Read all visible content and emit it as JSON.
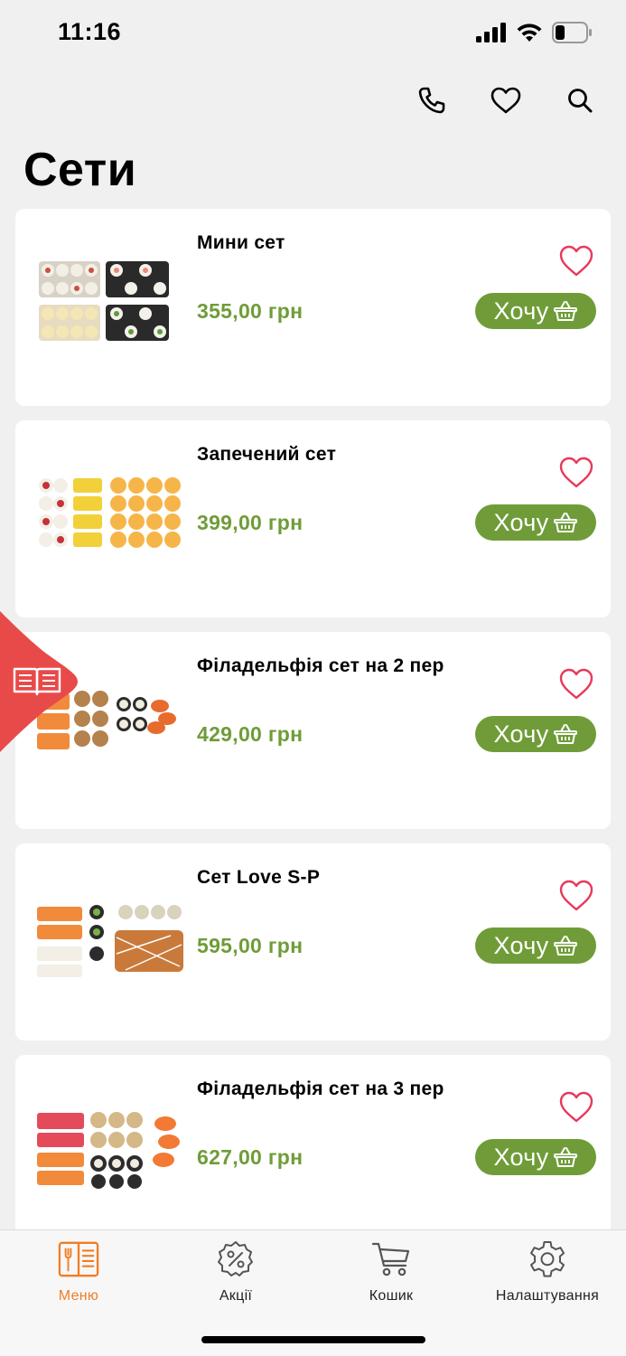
{
  "status": {
    "time": "11:16"
  },
  "page": {
    "title": "Сети"
  },
  "products": [
    {
      "name": "Мини сет",
      "price": "355,00 грн",
      "button": "Хочу"
    },
    {
      "name": "Запечений сет",
      "price": "399,00 грн",
      "button": "Хочу"
    },
    {
      "name": "Філадельфія сет на 2 пер",
      "price": "429,00 грн",
      "button": "Хочу"
    },
    {
      "name": "Сет Love S-P",
      "price": "595,00 грн",
      "button": "Хочу"
    },
    {
      "name": "Філадельфія сет на 3 пер",
      "price": "627,00 грн",
      "button": "Хочу"
    }
  ],
  "nav": [
    {
      "label": "Меню",
      "icon": "menu-book-icon",
      "active": true
    },
    {
      "label": "Акції",
      "icon": "discount-icon",
      "active": false
    },
    {
      "label": "Кошик",
      "icon": "cart-icon",
      "active": false
    },
    {
      "label": "Налаштування",
      "icon": "gear-icon",
      "active": false
    }
  ],
  "colors": {
    "accent": "#6f9c38",
    "heart": "#e8395a",
    "tab": "#e84a4a",
    "navActive": "#f07d24"
  }
}
